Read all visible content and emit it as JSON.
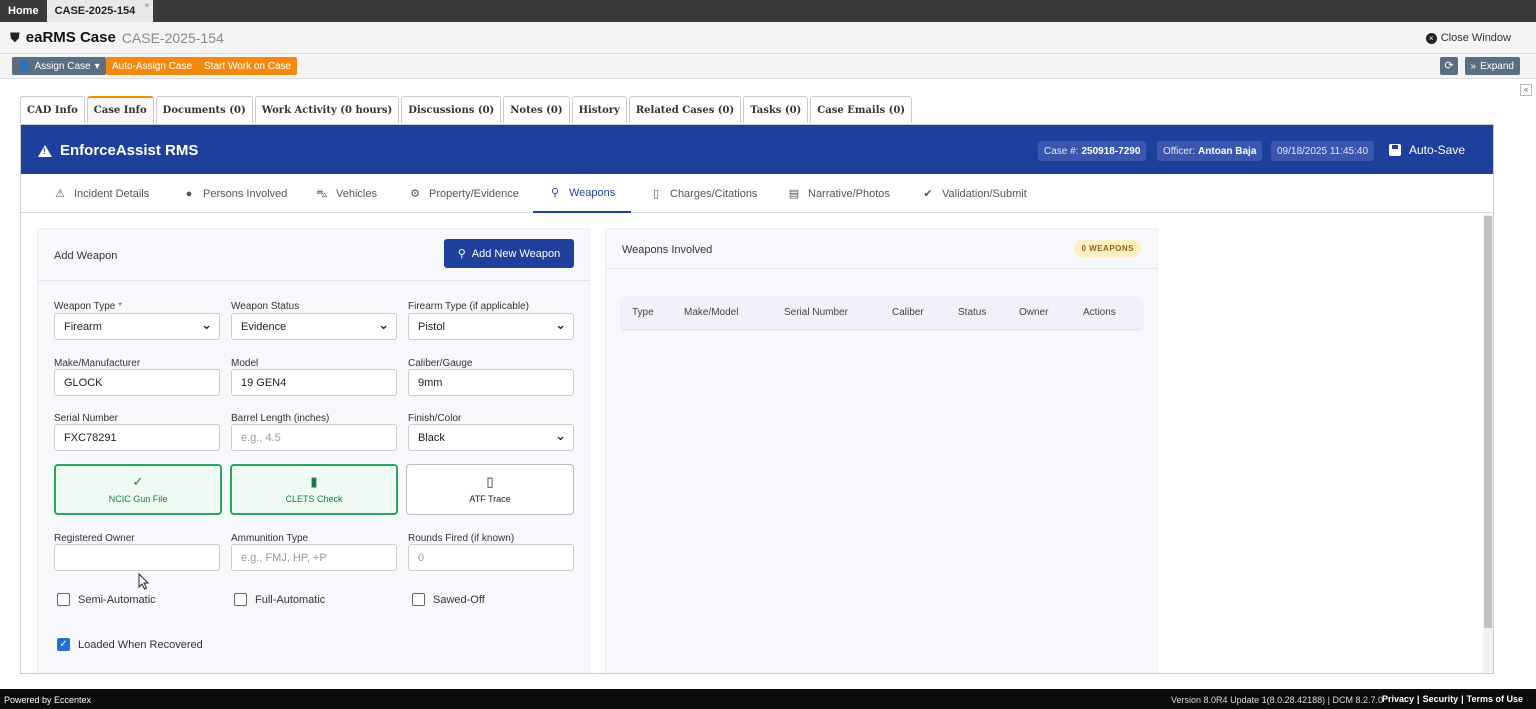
{
  "top_tabs": {
    "home": "Home",
    "case": "CASE-2025-154",
    "close": "×"
  },
  "case_header": {
    "app_name": "eaRMS Case",
    "case_id": "CASE-2025-154",
    "close_window": "Close Window"
  },
  "toolbar": {
    "assign": "Assign Case",
    "auto_assign": "Auto-Assign Case",
    "start_work": "Start Work on Case",
    "expand": "Expand"
  },
  "case_tabs": [
    "CAD Info",
    "Case Info",
    "Documents (0)",
    "Work Activity (0 hours)",
    "Discussions (0)",
    "Notes (0)",
    "History",
    "Related Cases (0)",
    "Tasks (0)",
    "Case Emails (0)"
  ],
  "app_header": {
    "brand": "EnforceAssist RMS",
    "case_label": "Case #:",
    "case_number": "250918-7290",
    "officer_label": "Officer:",
    "officer_name": "Antoan Baja",
    "datetime": "09/18/2025 11:45:40",
    "autosave": "Auto-Save"
  },
  "nav_tabs": [
    "Incident Details",
    "Persons Involved",
    "Vehicles",
    "Property/Evidence",
    "Weapons",
    "Charges/Citations",
    "Narrative/Photos",
    "Validation/Submit"
  ],
  "add_weapon": {
    "title": "Add Weapon",
    "add_button": "Add New Weapon",
    "weapon_type": {
      "label": "Weapon Type",
      "required": "*",
      "value": "Firearm"
    },
    "weapon_status": {
      "label": "Weapon Status",
      "value": "Evidence"
    },
    "firearm_type": {
      "label": "Firearm Type (if applicable)",
      "value": "Pistol"
    },
    "make": {
      "label": "Make/Manufacturer",
      "value": "GLOCK"
    },
    "model": {
      "label": "Model",
      "value": "19 GEN4"
    },
    "caliber": {
      "label": "Caliber/Gauge",
      "value": "9mm"
    },
    "serial": {
      "label": "Serial Number",
      "value": "FXC78291"
    },
    "barrel": {
      "label": "Barrel Length (inches)",
      "placeholder": "e.g., 4.5"
    },
    "finish": {
      "label": "Finish/Color",
      "value": "Black"
    },
    "ncic": "NCIC Gun File",
    "clets": "CLETS Check",
    "atf": "ATF Trace",
    "owner": {
      "label": "Registered Owner",
      "value": ""
    },
    "ammo": {
      "label": "Ammunition Type",
      "placeholder": "e.g., FMJ, HP, +P"
    },
    "rounds": {
      "label": "Rounds Fired (if known)",
      "placeholder": "0"
    },
    "semi_auto": "Semi-Automatic",
    "full_auto": "Full-Automatic",
    "sawed_off": "Sawed-Off",
    "loaded": "Loaded When Recovered"
  },
  "weapons_involved": {
    "title": "Weapons Involved",
    "badge": "0 WEAPONS",
    "columns": [
      "Type",
      "Make/Model",
      "Serial Number",
      "Caliber",
      "Status",
      "Owner",
      "Actions"
    ]
  },
  "footer": {
    "powered": "Powered by Eccentex",
    "version": "Version  8.0R4 Update 1(8.0.28.42188) | DCM 8.2.7.0",
    "privacy": "Privacy",
    "security": "Security",
    "terms": "Terms of Use"
  },
  "colors": {
    "primary": "#1f3f9c",
    "orange": "#f28a10",
    "green": "#28a760"
  }
}
